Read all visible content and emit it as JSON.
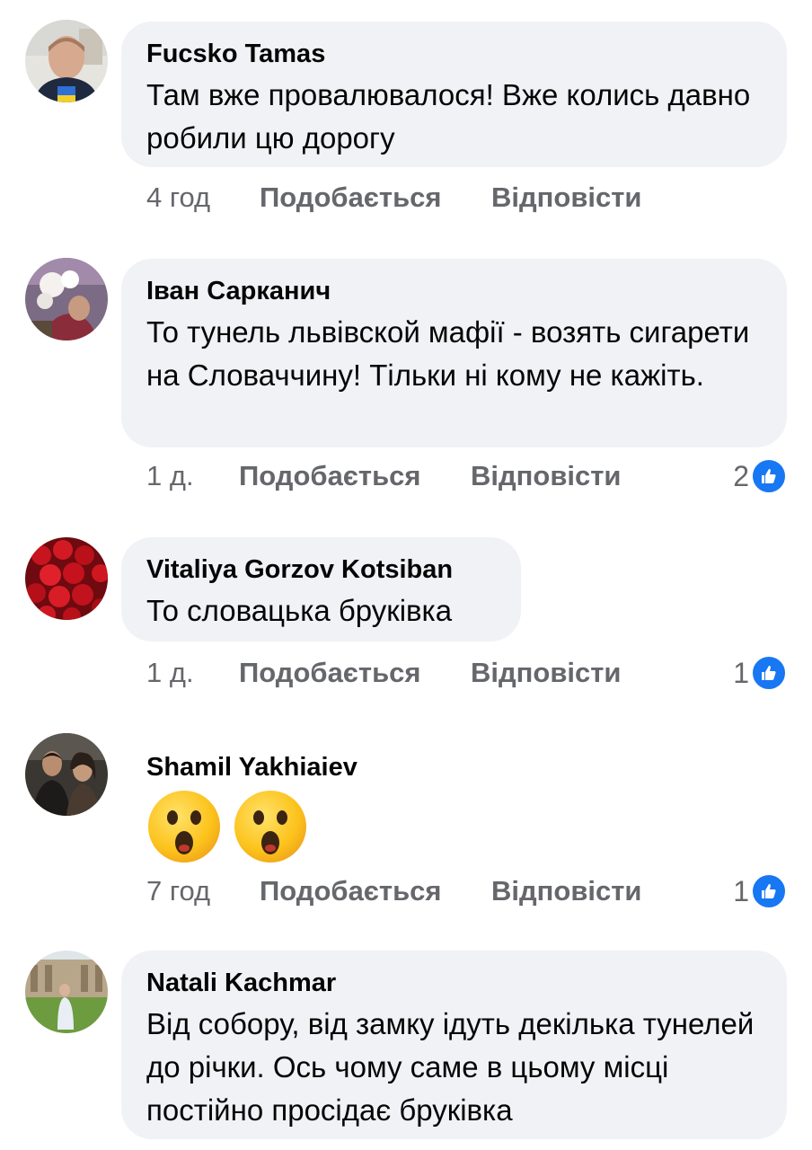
{
  "comments": [
    {
      "author": "Fucsko Tamas",
      "text": "Там вже провалювалося! Вже колись давно робили цю дорогу",
      "time": "4 год",
      "like_label": "Подобається",
      "reply_label": "Відповісти",
      "reactions": ""
    },
    {
      "author": "Іван Сарканич",
      "text": "То тунель львівской мафії - возять сигарети на Словаччину! Тільки ні кому не кажіть.",
      "time": "1 д.",
      "like_label": "Подобається",
      "reply_label": "Відповісти",
      "reactions": "2"
    },
    {
      "author": "Vitaliya Gorzov Kotsiban",
      "text": "То словацька бруківка",
      "time": "1 д.",
      "like_label": "Подобається",
      "reply_label": "Відповісти",
      "reactions": "1"
    },
    {
      "author": "Shamil Yakhiaiev",
      "emoji": [
        "surprised-face",
        "surprised-face"
      ],
      "time": "7 год",
      "like_label": "Подобається",
      "reply_label": "Відповісти",
      "reactions": "1"
    },
    {
      "author": "Natali Kachmar",
      "text": "Від собору, від замку ідуть декілька тунелей до річки. Ось чому саме в цьому місці постійно просідає бруківка"
    }
  ],
  "colors": {
    "bubble": "#f0f2f5",
    "text": "#050505",
    "meta": "#65676b",
    "like_badge": "#1877f2"
  }
}
